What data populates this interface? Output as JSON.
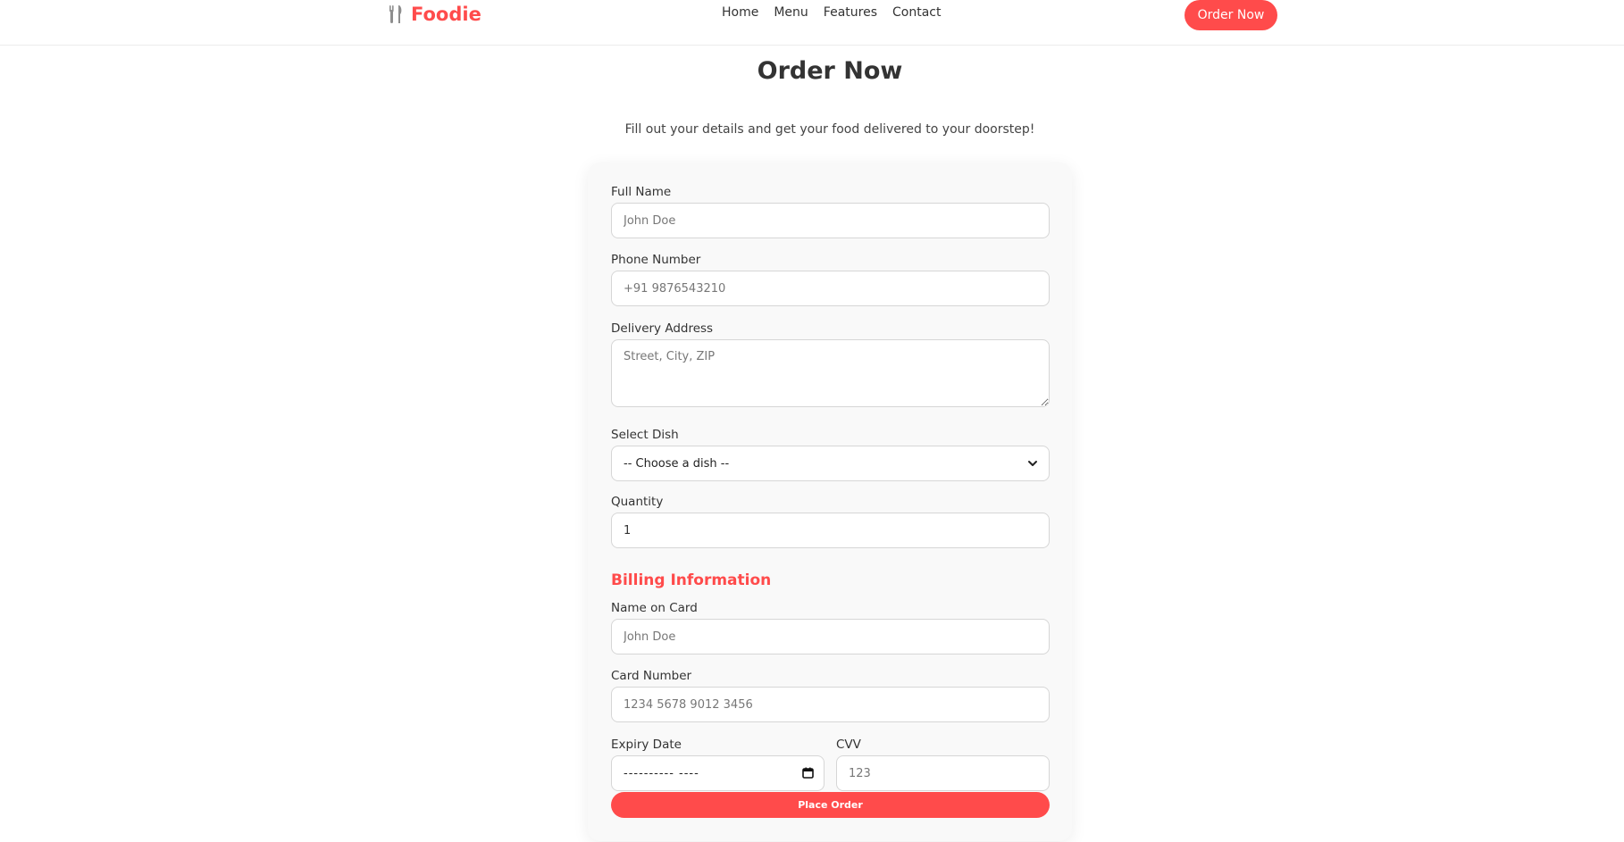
{
  "brand": {
    "name": "Foodie",
    "icon": "fork-knife-icon",
    "color": "#ff4b4b"
  },
  "nav": {
    "links": [
      "Home",
      "Menu",
      "Features",
      "Contact"
    ],
    "cta_label": "Order Now"
  },
  "page": {
    "title": "Order Now",
    "subtitle": "Fill out your details and get your food delivered to your doorstep!"
  },
  "form": {
    "full_name": {
      "label": "Full Name",
      "placeholder": "John Doe"
    },
    "phone": {
      "label": "Phone Number",
      "placeholder": "+91 9876543210"
    },
    "address": {
      "label": "Delivery Address",
      "placeholder": "Street, City, ZIP"
    },
    "dish": {
      "label": "Select Dish",
      "selected": "-- Choose a dish --"
    },
    "quantity": {
      "label": "Quantity",
      "value": "1"
    },
    "billing_heading": "Billing Information",
    "card_name": {
      "label": "Name on Card",
      "placeholder": "John Doe"
    },
    "card_number": {
      "label": "Card Number",
      "placeholder": "1234 5678 9012 3456"
    },
    "expiry": {
      "label": "Expiry Date",
      "value": "---------- ----"
    },
    "cvv": {
      "label": "CVV",
      "placeholder": "123"
    },
    "submit_label": "Place Order"
  },
  "colors": {
    "accent": "#ff4b4b",
    "card_bg": "#f9f9f9",
    "border": "#d6d6d6"
  }
}
